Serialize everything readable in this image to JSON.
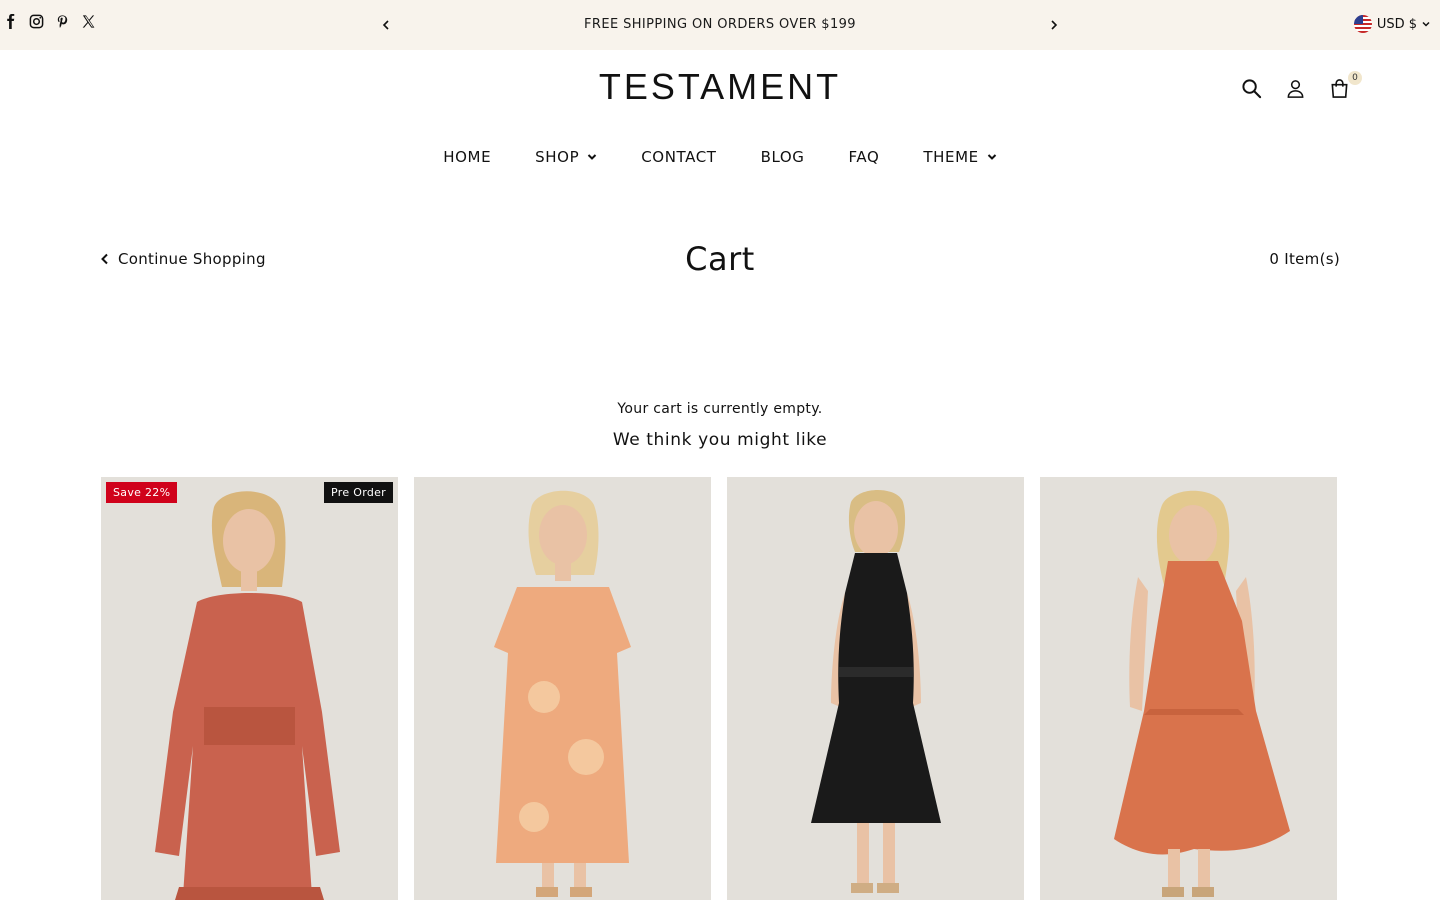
{
  "announcement": {
    "text": "FREE SHIPPING ON ORDERS OVER $199",
    "currency": "USD $",
    "social_icons": [
      "facebook-icon",
      "instagram-icon",
      "pinterest-icon",
      "x-icon"
    ]
  },
  "header": {
    "logo": "TESTAMENT",
    "cart_count": "0"
  },
  "nav": {
    "items": [
      "HOME",
      "SHOP",
      "CONTACT",
      "BLOG",
      "FAQ",
      "THEME"
    ]
  },
  "cart": {
    "continue_label": "Continue Shopping",
    "title": "Cart",
    "item_count": "0 Item(s)",
    "empty_message": "Your cart is currently empty.",
    "suggest_heading": "We think you might like"
  },
  "products": [
    {
      "sale_badge": "Save 22%",
      "status_badge": "Pre Order",
      "dress_color": "#c9624e"
    },
    {
      "dress_color": "#eeaa7e"
    },
    {
      "dress_color": "#1a1a1a"
    },
    {
      "dress_color": "#d9734c"
    }
  ],
  "colors": {
    "announcement_bg": "#f8f3ec",
    "sale_badge": "#d0021b",
    "status_badge": "#111111",
    "image_bg": "#e3e0da"
  }
}
